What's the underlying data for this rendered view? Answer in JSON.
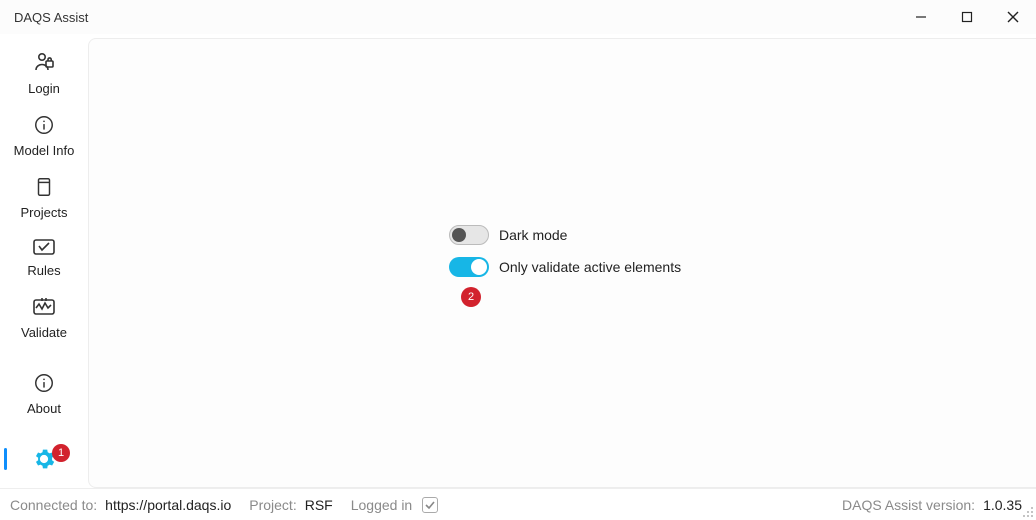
{
  "window": {
    "title": "DAQS Assist"
  },
  "sidebar": {
    "items": [
      {
        "id": "login",
        "label": "Login"
      },
      {
        "id": "modelinfo",
        "label": "Model Info"
      },
      {
        "id": "projects",
        "label": "Projects"
      },
      {
        "id": "rules",
        "label": "Rules"
      },
      {
        "id": "validate",
        "label": "Validate"
      },
      {
        "id": "about",
        "label": "About"
      }
    ],
    "settings": {
      "badge": "1",
      "active": true
    }
  },
  "settings": {
    "darkmode": {
      "label": "Dark mode",
      "value": false
    },
    "onlyactive": {
      "label": "Only validate active elements",
      "value": true
    },
    "badge": "2"
  },
  "status": {
    "connected_label": "Connected to:",
    "connected_value": "https://portal.daqs.io",
    "project_label": "Project:",
    "project_value": "RSF",
    "loggedin_label": "Logged in",
    "loggedin_value": true,
    "version_label": "DAQS Assist version:",
    "version_value": "1.0.35"
  },
  "colors": {
    "accent": "#17b6e6",
    "badge": "#d2222d",
    "active_indicator": "#0e8efc"
  }
}
